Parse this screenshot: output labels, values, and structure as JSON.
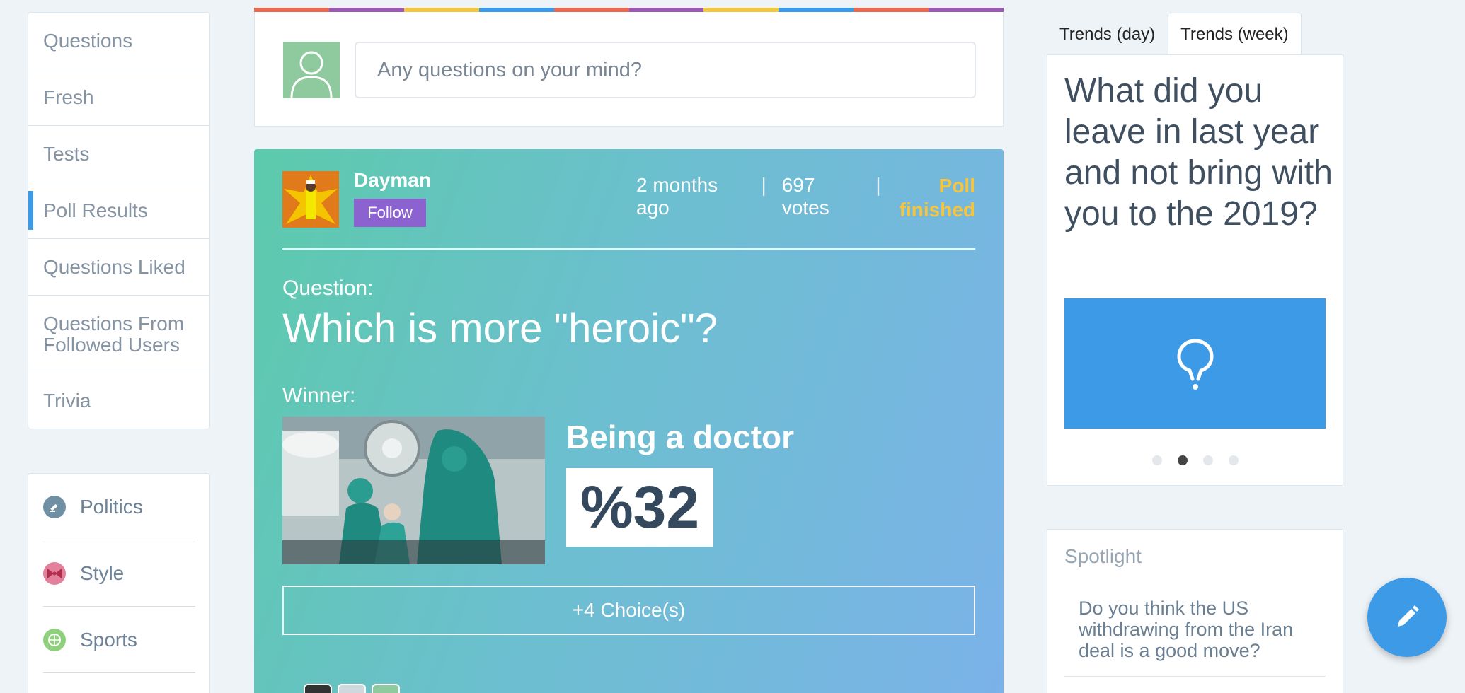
{
  "nav": {
    "items": [
      {
        "label": "Questions"
      },
      {
        "label": "Fresh"
      },
      {
        "label": "Tests"
      },
      {
        "label": "Poll Results",
        "active": true
      },
      {
        "label": "Questions Liked"
      },
      {
        "label": "Questions From Followed Users"
      },
      {
        "label": "Trivia"
      }
    ]
  },
  "categories": [
    {
      "label": "Politics",
      "icon": "gavel-icon",
      "color": "#6f8fa3"
    },
    {
      "label": "Style",
      "icon": "bowtie-icon",
      "color": "#e3809b"
    },
    {
      "label": "Sports",
      "icon": "ball-icon",
      "color": "#8fd07c"
    }
  ],
  "ask": {
    "placeholder": "Any questions on your mind?",
    "stripe_colors": [
      "#e96b4f",
      "#9b59b6",
      "#f4c542",
      "#3d9ae6",
      "#e96b4f",
      "#9b59b6",
      "#f4c542",
      "#3d9ae6",
      "#e96b4f",
      "#9b59b6"
    ]
  },
  "poll": {
    "user": "Dayman",
    "follow_label": "Follow",
    "time": "2 months ago",
    "votes": "697 votes",
    "status": "Poll finished",
    "question_label": "Question:",
    "question": "Which is more \"heroic\"?",
    "winner_label": "Winner:",
    "winner": "Being a doctor",
    "percent": "%32",
    "more_choices": "+4 Choice(s)"
  },
  "trends": {
    "tabs": [
      {
        "label": "Trends (day)"
      },
      {
        "label": "Trends (week)",
        "active": true
      }
    ],
    "question": "What did you leave in last year and not bring with you to the 2019?",
    "image_color": "#3d9ae6",
    "active_dot": 1,
    "dot_count": 4
  },
  "spotlight": {
    "title": "Spotlight",
    "question": "Do you think the US withdrawing from the Iran deal is a good move?"
  },
  "colors": {
    "accent": "#3d9ae6",
    "follow": "#8b62cf",
    "finished": "#f7c43e"
  }
}
